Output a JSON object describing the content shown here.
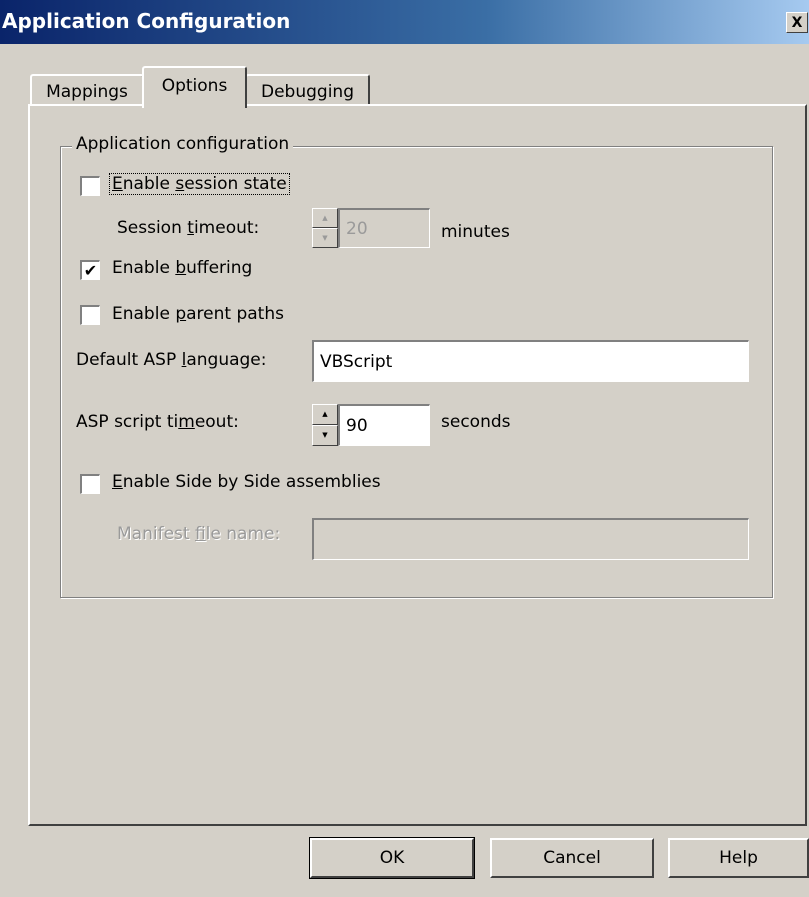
{
  "window": {
    "title": "Application Configuration",
    "close_glyph": "X"
  },
  "tabs": [
    {
      "label": "Mappings",
      "active": false
    },
    {
      "label": "Options",
      "active": true
    },
    {
      "label": "Debugging",
      "active": false
    }
  ],
  "group": {
    "label": "Application configuration"
  },
  "session_state": {
    "label_pre": "",
    "label_u": "E",
    "label_post": "nable ",
    "label_u2": "s",
    "label_post2": "ession state",
    "checked": false
  },
  "session_timeout": {
    "label_pre": "Session ",
    "label_u": "t",
    "label_post": "imeout:",
    "value": "20",
    "unit": "minutes",
    "enabled": false
  },
  "buffering": {
    "label_pre": "Enable ",
    "label_u": "b",
    "label_post": "uffering",
    "checked": true
  },
  "parent_paths": {
    "label_pre": "Enable ",
    "label_u": "p",
    "label_post": "arent paths",
    "checked": false
  },
  "asp_language": {
    "label_pre": "Default ASP ",
    "label_u": "l",
    "label_post": "anguage:",
    "value": "VBScript"
  },
  "asp_timeout": {
    "label_pre": "ASP script ti",
    "label_u": "m",
    "label_post": "eout:",
    "value": "90",
    "unit": "seconds"
  },
  "side_by_side": {
    "label_pre": "",
    "label_u": "E",
    "label_post": "nable Side by Side assemblies",
    "checked": false
  },
  "manifest": {
    "label_pre": "Manifest ",
    "label_u": "f",
    "label_post": "ile name:",
    "value": "",
    "enabled": false
  },
  "buttons": {
    "ok": "OK",
    "cancel": "Cancel",
    "help": "Help"
  },
  "icons": {
    "check": "✔",
    "spin_up": "▲",
    "spin_down": "▼"
  }
}
